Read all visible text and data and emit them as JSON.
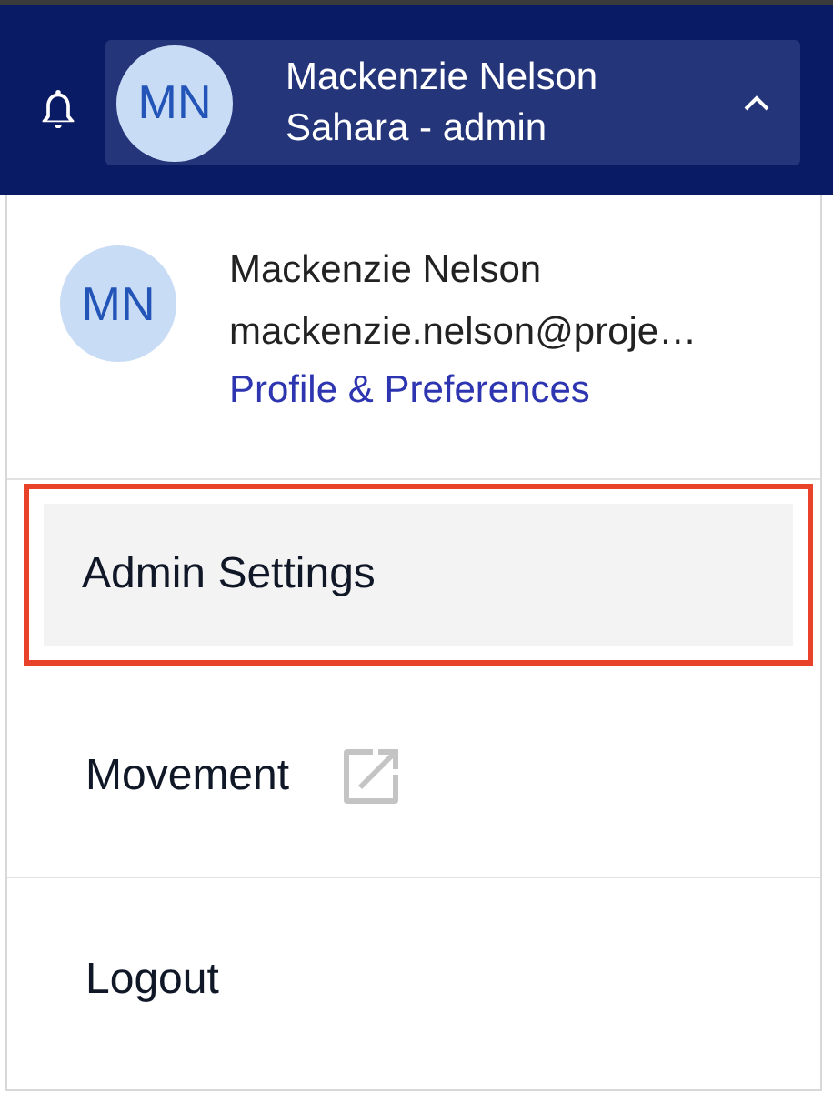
{
  "header": {
    "account": {
      "initials": "MN",
      "name": "Mackenzie Nelson",
      "role": "Sahara - admin",
      "expanded": true
    }
  },
  "menu": {
    "profile": {
      "initials": "MN",
      "name": "Mackenzie Nelson",
      "email": "mackenzie.nelson@proje…",
      "link": "Profile & Preferences"
    },
    "items": [
      {
        "label": "Admin Settings",
        "selected": true,
        "external": false
      },
      {
        "label": "Movement",
        "selected": false,
        "external": true
      },
      {
        "label": "Logout",
        "selected": false,
        "external": false
      }
    ]
  }
}
